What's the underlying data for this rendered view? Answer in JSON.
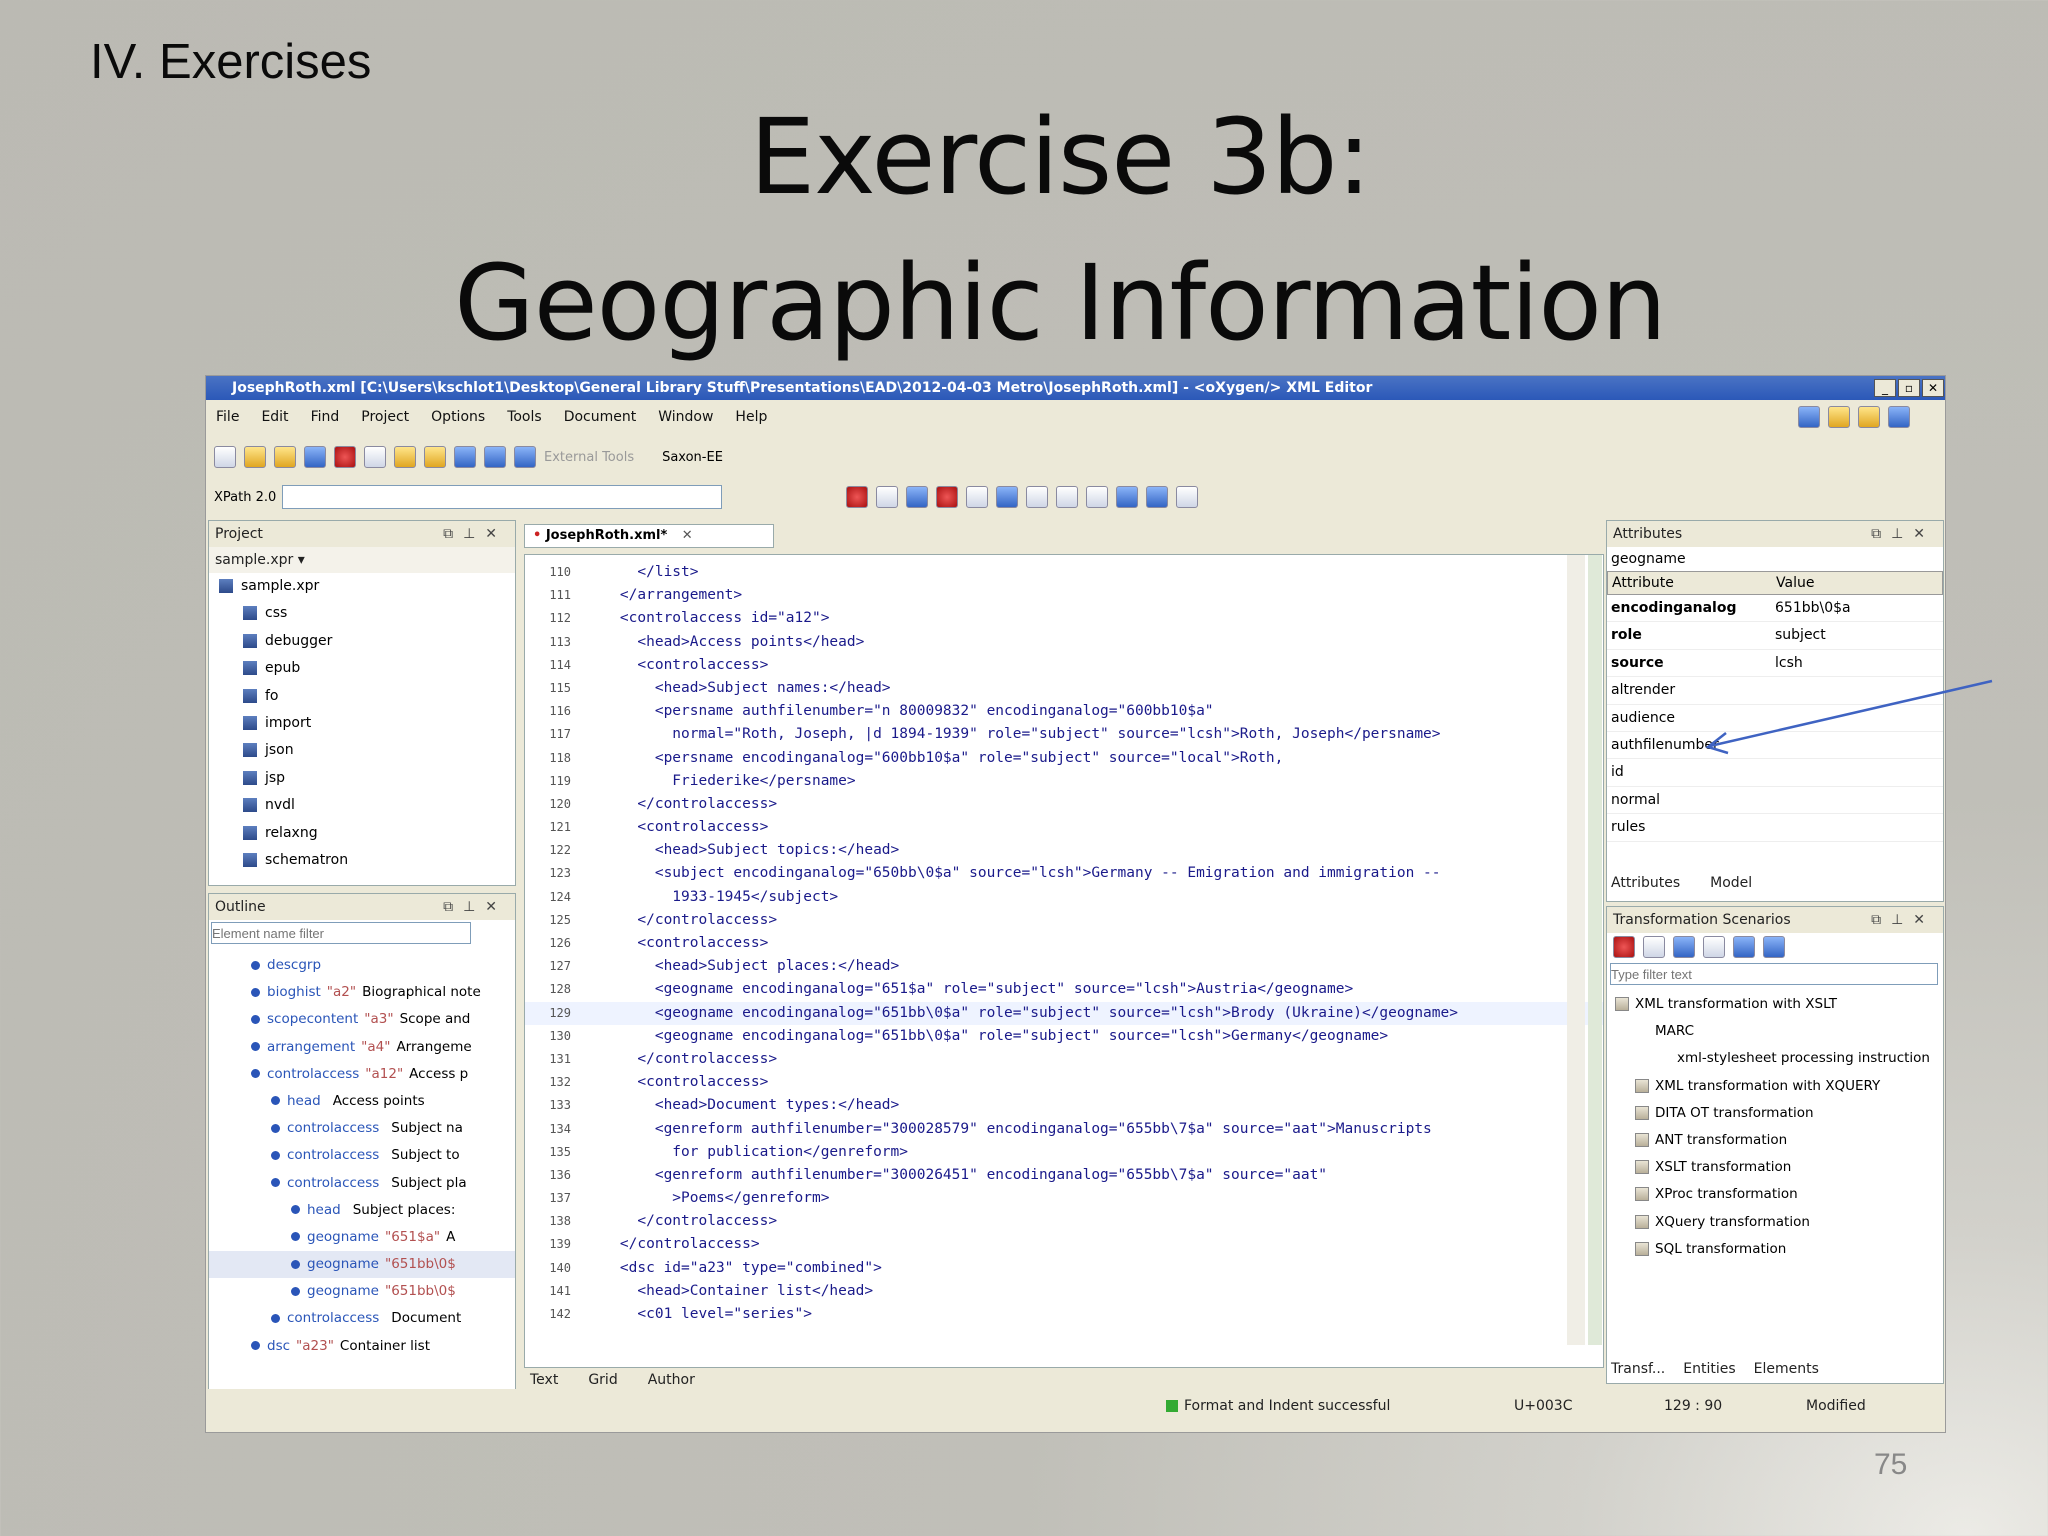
{
  "slide": {
    "section": "IV. Exercises",
    "title_line1": "Exercise 3b:",
    "title_line2": "Geographic Information",
    "number": "75"
  },
  "window": {
    "title": "JosephRoth.xml [C:\\Users\\kschlot1\\Desktop\\General Library Stuff\\Presentations\\EAD\\2012-04-03 Metro\\JosephRoth.xml] - <oXygen/> XML Editor"
  },
  "menu": [
    "File",
    "Edit",
    "Find",
    "Project",
    "Options",
    "Tools",
    "Document",
    "Window",
    "Help"
  ],
  "toolbar": {
    "external_tools": "External Tools",
    "engine": "Saxon-EE",
    "xpath_version": "XPath 2.0",
    "xpath_value": ""
  },
  "project": {
    "title": "Project",
    "file": "sample.xpr",
    "root": "sample.xpr",
    "folders": [
      "css",
      "debugger",
      "epub",
      "fo",
      "import",
      "json",
      "jsp",
      "nvdl",
      "relaxng",
      "schematron"
    ]
  },
  "outline": {
    "title": "Outline",
    "filter_placeholder": "Element name filter",
    "rows": [
      {
        "tag": "descgrp",
        "attr": "",
        "text": ""
      },
      {
        "tag": "bioghist",
        "attr": "\"a2\"",
        "text": "Biographical note"
      },
      {
        "tag": "scopecontent",
        "attr": "\"a3\"",
        "text": "Scope and"
      },
      {
        "tag": "arrangement",
        "attr": "\"a4\"",
        "text": "Arrangeme"
      },
      {
        "tag": "controlaccess",
        "attr": "\"a12\"",
        "text": "Access p"
      },
      {
        "tag": "head",
        "attr": "",
        "text": "Access points"
      },
      {
        "tag": "controlaccess",
        "attr": "",
        "text": "Subject na"
      },
      {
        "tag": "controlaccess",
        "attr": "",
        "text": "Subject to"
      },
      {
        "tag": "controlaccess",
        "attr": "",
        "text": "Subject pla"
      },
      {
        "tag": "head",
        "attr": "",
        "text": "Subject places:"
      },
      {
        "tag": "geogname",
        "attr": "\"651$a\"",
        "text": "A"
      },
      {
        "tag": "geogname",
        "attr": "\"651bb\\0$",
        "text": ""
      },
      {
        "tag": "geogname",
        "attr": "\"651bb\\0$",
        "text": ""
      },
      {
        "tag": "controlaccess",
        "attr": "",
        "text": "Document"
      },
      {
        "tag": "dsc",
        "attr": "\"a23\"",
        "text": "Container list"
      }
    ]
  },
  "editor": {
    "tab": "JosephRoth.xml*",
    "bottom_tabs": [
      "Text",
      "Grid",
      "Author"
    ],
    "lines": [
      {
        "n": "110",
        "t": "      </list>"
      },
      {
        "n": "111",
        "t": "    </arrangement>"
      },
      {
        "n": "112",
        "t": "    <controlaccess id=\"a12\">"
      },
      {
        "n": "113",
        "t": "      <head>Access points</head>"
      },
      {
        "n": "114",
        "t": "      <controlaccess>"
      },
      {
        "n": "115",
        "t": "        <head>Subject names:</head>"
      },
      {
        "n": "116",
        "t": "        <persname authfilenumber=\"n 80009832\" encodinganalog=\"600bb10$a\""
      },
      {
        "n": "117",
        "t": "          normal=\"Roth, Joseph, |d 1894-1939\" role=\"subject\" source=\"lcsh\">Roth, Joseph</persname>"
      },
      {
        "n": "118",
        "t": "        <persname encodinganalog=\"600bb10$a\" role=\"subject\" source=\"local\">Roth,"
      },
      {
        "n": "119",
        "t": "          Friederike</persname>"
      },
      {
        "n": "120",
        "t": "      </controlaccess>"
      },
      {
        "n": "121",
        "t": "      <controlaccess>"
      },
      {
        "n": "122",
        "t": "        <head>Subject topics:</head>"
      },
      {
        "n": "123",
        "t": "        <subject encodinganalog=\"650bb\\0$a\" source=\"lcsh\">Germany -- Emigration and immigration --"
      },
      {
        "n": "124",
        "t": "          1933-1945</subject>"
      },
      {
        "n": "125",
        "t": "      </controlaccess>"
      },
      {
        "n": "126",
        "t": "      <controlaccess>"
      },
      {
        "n": "127",
        "t": "        <head>Subject places:</head>"
      },
      {
        "n": "128",
        "t": "        <geogname encodinganalog=\"651$a\" role=\"subject\" source=\"lcsh\">Austria</geogname>"
      },
      {
        "n": "129",
        "t": "        <geogname encodinganalog=\"651bb\\0$a\" role=\"subject\" source=\"lcsh\">Brody (Ukraine)</geogname>"
      },
      {
        "n": "130",
        "t": "        <geogname encodinganalog=\"651bb\\0$a\" role=\"subject\" source=\"lcsh\">Germany</geogname>"
      },
      {
        "n": "131",
        "t": "      </controlaccess>"
      },
      {
        "n": "132",
        "t": "      <controlaccess>"
      },
      {
        "n": "133",
        "t": "        <head>Document types:</head>"
      },
      {
        "n": "134",
        "t": "        <genreform authfilenumber=\"300028579\" encodinganalog=\"655bb\\7$a\" source=\"aat\">Manuscripts"
      },
      {
        "n": "135",
        "t": "          for publication</genreform>"
      },
      {
        "n": "136",
        "t": "        <genreform authfilenumber=\"300026451\" encodinganalog=\"655bb\\7$a\" source=\"aat\""
      },
      {
        "n": "137",
        "t": "          >Poems</genreform>"
      },
      {
        "n": "138",
        "t": "      </controlaccess>"
      },
      {
        "n": "139",
        "t": "    </controlaccess>"
      },
      {
        "n": "140",
        "t": "    <dsc id=\"a23\" type=\"combined\">"
      },
      {
        "n": "141",
        "t": "      <head>Container list</head>"
      },
      {
        "n": "142",
        "t": "      <c01 level=\"series\">"
      }
    ]
  },
  "attributes": {
    "title": "Attributes",
    "element": "geogname",
    "col_attribute": "Attribute",
    "col_value": "Value",
    "rows": [
      {
        "name": "encodinganalog",
        "value": "651bb\\0$a"
      },
      {
        "name": "role",
        "value": "subject"
      },
      {
        "name": "source",
        "value": "lcsh"
      },
      {
        "name": "altrender",
        "value": ""
      },
      {
        "name": "audience",
        "value": ""
      },
      {
        "name": "authfilenumber",
        "value": ""
      },
      {
        "name": "id",
        "value": ""
      },
      {
        "name": "normal",
        "value": ""
      },
      {
        "name": "rules",
        "value": ""
      }
    ],
    "tabs": [
      "Attributes",
      "Model"
    ]
  },
  "scenarios": {
    "title": "Transformation Scenarios",
    "filter_placeholder": "Type filter text",
    "items": [
      "XML transformation with XSLT",
      "MARC",
      "xml-stylesheet processing instruction",
      "XML transformation with XQUERY",
      "DITA OT transformation",
      "ANT transformation",
      "XSLT transformation",
      "XProc transformation",
      "XQuery transformation",
      "SQL transformation"
    ],
    "tabs": [
      "Transf...",
      "Entities",
      "Elements"
    ]
  },
  "status": {
    "message": "Format and Indent successful",
    "unicode": "U+003C",
    "position": "129 : 90",
    "state": "Modified"
  },
  "colors": {
    "titlebar": "#2b58b8",
    "tag": "#1a1a8a",
    "attr_name": "#c87878"
  }
}
